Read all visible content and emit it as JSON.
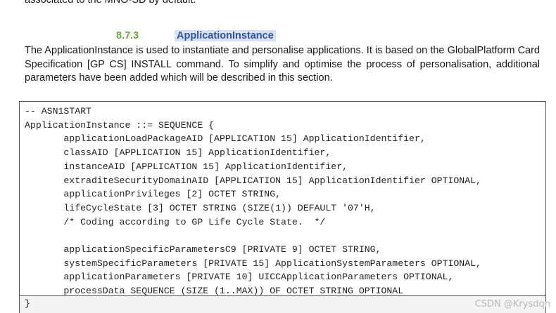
{
  "top_text": "associated to the MNO-SD by default.",
  "section": {
    "number": "8.7.3",
    "title": "ApplicationInstance"
  },
  "paragraph": "The ApplicationInstance is used to instantiate and personalise applications. It is based on the GlobalPlatform Card Specification [GP CS] INSTALL command. To simplify and optimise the process of personalisation, additional parameters have been added which will be described in this section.",
  "code_lines": [
    "-- ASN1START",
    "ApplicationInstance ::= SEQUENCE {",
    "       applicationLoadPackageAID [APPLICATION 15] ApplicationIdentifier,",
    "       classAID [APPLICATION 15] ApplicationIdentifier,",
    "       instanceAID [APPLICATION 15] ApplicationIdentifier,",
    "       extraditeSecurityDomainAID [APPLICATION 15] ApplicationIdentifier OPTIONAL,",
    "       applicationPrivileges [2] OCTET STRING,",
    "       lifeCycleState [3] OCTET STRING (SIZE(1)) DEFAULT '07'H,",
    "       /* Coding according to GP Life Cycle State.  */",
    "",
    "       applicationSpecificParametersC9 [PRIVATE 9] OCTET STRING,",
    "       systemSpecificParameters [PRIVATE 15] ApplicationSystemParameters OPTIONAL,",
    "       applicationParameters [PRIVATE 10] UICCApplicationParameters OPTIONAL,",
    "       processData SEQUENCE (SIZE (1..MAX)) OF OCTET STRING OPTIONAL"
  ],
  "code_closing": "}",
  "watermark": "CSDN @Krysdqn",
  "colors": {
    "section_number": "#6aa83a",
    "section_title": "#2f55a3",
    "title_highlight": "#d8e0f2"
  }
}
